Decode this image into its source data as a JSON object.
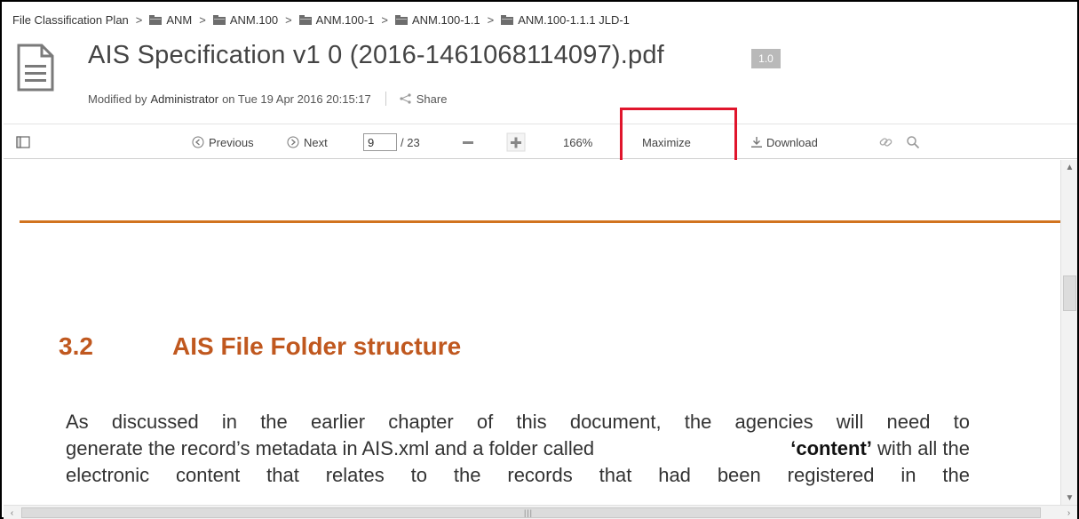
{
  "breadcrumb": {
    "root": "File Classification Plan",
    "folders": [
      "ANM",
      "ANM.100",
      "ANM.100-1",
      "ANM.100-1.1",
      "ANM.100-1.1.1 JLD-1"
    ],
    "separator": ">"
  },
  "document": {
    "title": "AIS Specification v1 0 (2016-1461068114097).pdf",
    "version": "1.0",
    "modified_prefix": "Modified by",
    "modified_user": "Administrator",
    "modified_suffix": "on Tue 19 Apr 2016 20:15:17",
    "share_label": "Share"
  },
  "toolbar": {
    "previous_label": "Previous",
    "next_label": "Next",
    "page_current": "9",
    "page_total": "/ 23",
    "zoom_level": "166%",
    "maximize_label": "Maximize",
    "download_label": "Download"
  },
  "viewer": {
    "section_number": "3.2",
    "section_title": "AIS File Folder structure",
    "paragraph_lines": [
      "As discussed in the earlier chapter of this document, the agencies will need to",
      "generate the record’s metadata in AIS.xml and a folder called",
      "electronic content that relates to the records that had been registered in the"
    ],
    "content_term": "‘content’",
    "content_suffix": "with all the"
  },
  "colors": {
    "accent_orange": "#c0581f",
    "highlight_red": "#e0152c",
    "badge_gray": "#b9b9b9"
  },
  "icons": [
    "folder-icon",
    "document-icon",
    "share-icon",
    "sidebar-toggle-icon",
    "previous-arrow-icon",
    "next-arrow-icon",
    "zoom-out-icon",
    "zoom-in-icon",
    "download-icon",
    "link-icon",
    "search-icon"
  ]
}
